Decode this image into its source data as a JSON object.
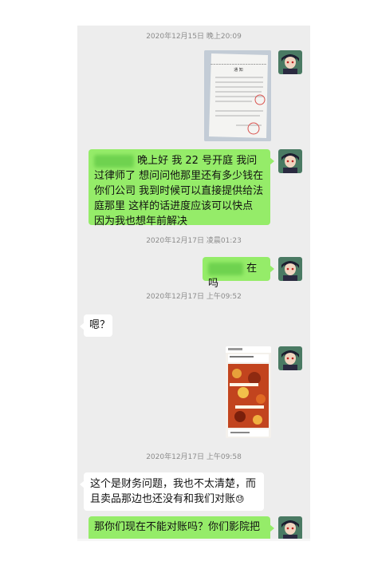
{
  "messages": {
    "ts1": "2020年12月15日 晚上20:09",
    "msg2_text": "晚上好 我 22 号开庭 我问过律师了 想问问他那里还有多少钱在你们公司 我到时候可以直接提供给法庭那里 这样的话进度应该可以快点 因为我也想年前解决",
    "ts2": "2020年12月17日 凌晨01:23",
    "msg3_text": "在吗",
    "ts3": "2020年12月17日 上午09:52",
    "msg4_text": "嗯？",
    "ts4": "2020年12月17日 上午09:58",
    "msg6_text": "这个是财务问题，我也不太清楚，而且卖品那边也还没有和我们对账",
    "msg6_emoji": "😓",
    "msg7_text": "那你们现在不能对账吗？你们影院把"
  },
  "document_image": {
    "heading": "通  知"
  },
  "colors": {
    "chat_bg": "#ededed",
    "sent_bubble": "#95ec69",
    "received_bubble": "#ffffff",
    "timestamp": "#8c8c8c"
  },
  "icons": {
    "sender_avatar": "anime-character-avatar"
  }
}
